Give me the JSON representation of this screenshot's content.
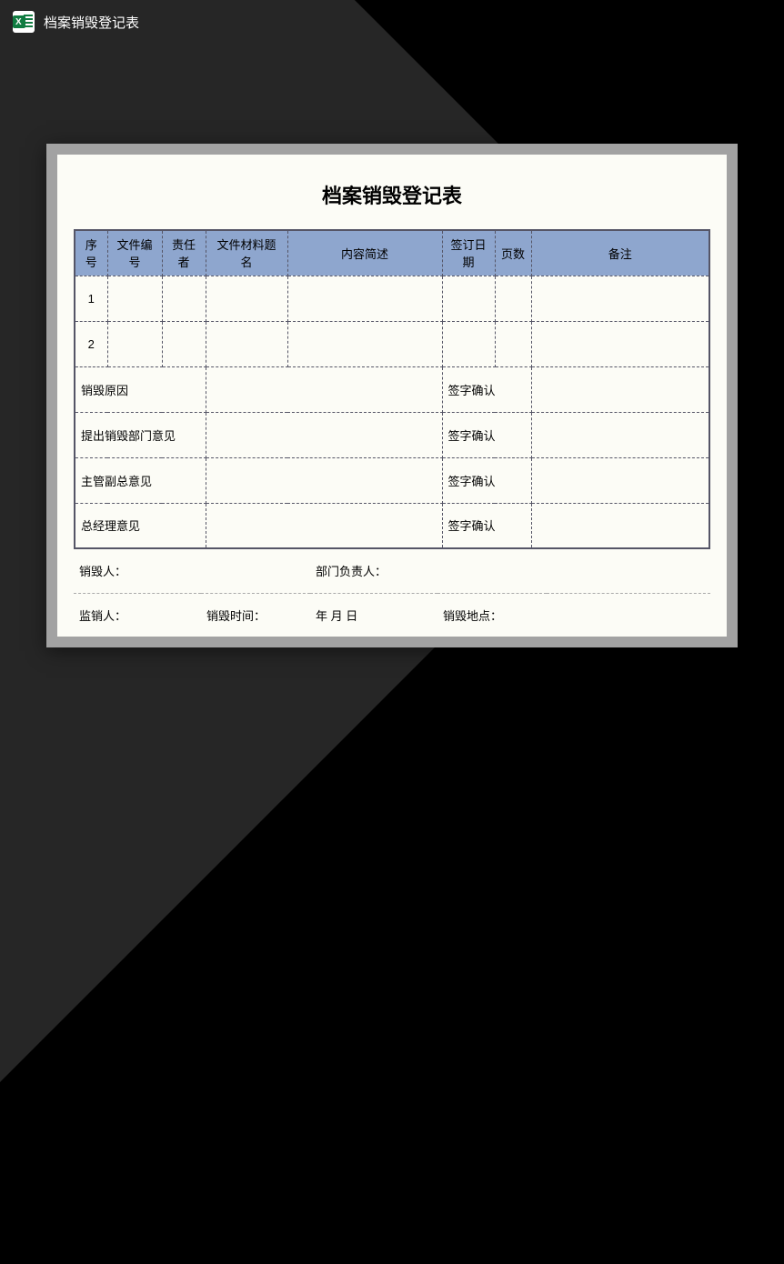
{
  "header": {
    "title": "档案销毁登记表"
  },
  "document": {
    "title": "档案销毁登记表",
    "table": {
      "headers": {
        "seq": "序号",
        "fileNum": "文件编号",
        "responsible": "责任者",
        "materialName": "文件材料题名",
        "description": "内容简述",
        "signDate": "签订日期",
        "pages": "页数",
        "note": "备注"
      },
      "rows": [
        {
          "seq": "1",
          "fileNum": "",
          "responsible": "",
          "materialName": "",
          "description": "",
          "signDate": "",
          "pages": "",
          "note": ""
        },
        {
          "seq": "2",
          "fileNum": "",
          "responsible": "",
          "materialName": "",
          "description": "",
          "signDate": "",
          "pages": "",
          "note": ""
        }
      ],
      "reasonLabel": "销毁原因",
      "deptOpinionLabel": "提出销毁部门意见",
      "viceOpinionLabel": "主管副总意见",
      "gmOpinionLabel": "总经理意见",
      "signConfirm": "签字确认"
    },
    "footer": {
      "destroyer": "销毁人：",
      "deptHead": "部门负责人：",
      "supervisor": "监销人：",
      "destroyTime": "销毁时间：",
      "dateFormat": "年   月   日",
      "destroyPlace": "销毁地点："
    }
  }
}
